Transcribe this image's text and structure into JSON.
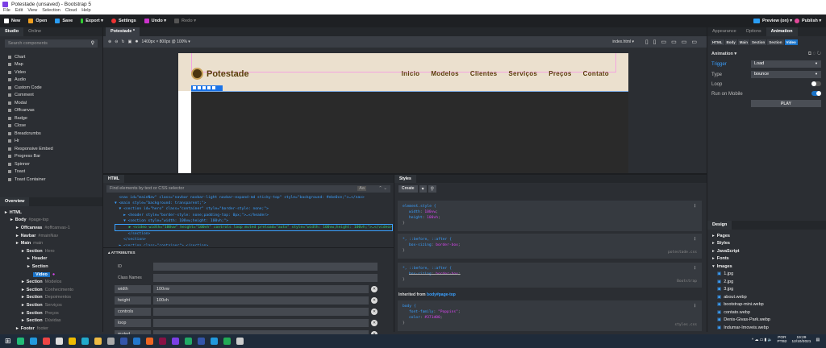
{
  "window": {
    "title": "Potestade (unsaved) - Bootstrap 5"
  },
  "menu": [
    "File",
    "Edit",
    "View",
    "Selection",
    "Cloud",
    "Help"
  ],
  "toolbar": {
    "new": "New",
    "open": "Open",
    "save": "Save",
    "export": "Export ▾",
    "settings": "Settings",
    "undo": "Undo ▾",
    "redo": "Redo ▾",
    "preview": "Preview (on) ▾",
    "publish": "Publish ▾"
  },
  "left": {
    "tabs": [
      "Studio",
      "Online"
    ],
    "search_placeholder": "Search components",
    "components": [
      "Chart",
      "Map",
      "Video",
      "Audio",
      "Custom Code",
      "Comment",
      "Modal",
      "Offcanvas",
      "Badge",
      "Close",
      "Breadcrumbs",
      "Hr",
      "Responsive Embed",
      "Progress Bar",
      "Spinner",
      "Toast",
      "Toast Container"
    ],
    "overview_tab": "Overview",
    "tree": [
      {
        "label": "HTML",
        "sub": "",
        "lvl": 0
      },
      {
        "label": "Body",
        "sub": "#page-top",
        "lvl": 1
      },
      {
        "label": "Offcanvas",
        "sub": "#offcanvas-1",
        "lvl": 2
      },
      {
        "label": "Navbar",
        "sub": "#mainNav",
        "lvl": 2
      },
      {
        "label": "Main",
        "sub": "main",
        "lvl": 2
      },
      {
        "label": "Section",
        "sub": "Hero",
        "lvl": 3
      },
      {
        "label": "Header",
        "sub": "",
        "lvl": 4
      },
      {
        "label": "Section",
        "sub": "",
        "lvl": 4
      },
      {
        "label": "Video",
        "sub": "",
        "lvl": 5,
        "selected": true
      },
      {
        "label": "Section",
        "sub": "Modelos",
        "lvl": 3
      },
      {
        "label": "Section",
        "sub": "Conhecimento",
        "lvl": 3
      },
      {
        "label": "Section",
        "sub": "Depoimentos",
        "lvl": 3
      },
      {
        "label": "Section",
        "sub": "Serviços",
        "lvl": 3
      },
      {
        "label": "Section",
        "sub": "Preços",
        "lvl": 3
      },
      {
        "label": "Section",
        "sub": "Dúvidas",
        "lvl": 3
      },
      {
        "label": "Footer",
        "sub": "footer",
        "lvl": 2
      }
    ]
  },
  "canvas": {
    "tab": "Potestade *",
    "size": "1400px × 800px @ 100% ▾",
    "file": "index.html ▾",
    "site": {
      "brand": "Potestade",
      "nav": [
        "Inicio",
        "Modelos",
        "Clientes",
        "Serviços",
        "Preços",
        "Contato"
      ]
    }
  },
  "html_panel": {
    "tab": "HTML",
    "find_placeholder": "Find elements by text or CSS selector",
    "case": "Aa",
    "lines": [
      "  <nav id=\"mainNav\" class=\"navbar navbar-light navbar-expand-md sticky-top\" style=\"background: #ebe0ce;\">…</nav>",
      "▼ <main style=\"background: transparent;\">",
      "  ▼ <section id=\"hero\" class=\"container\" style=\"border-style: none;\">",
      "    ▶ <header style=\"border-style: none;padding-top: 0px;\">…</header>",
      "    ▼ <section style=\"width: 100vw;height: 100vh;\">",
      "      ▶ <video width=\"100vw\" height=\"100vh\" controls loop muted preload=\"auto\" style=\"width: 100vw;height: 100vh;\">…</video>",
      "      </section>",
      "    </section>",
      "  ▶ <section class=\"container\">…</section>"
    ],
    "attributes_title": "ATTRIBUTES",
    "attrs": [
      {
        "k": "ID",
        "v": ""
      },
      {
        "k": "Class Names",
        "v": ""
      },
      {
        "k": "width",
        "v": "100vw"
      },
      {
        "k": "height",
        "v": "100vh"
      },
      {
        "k": "controls",
        "v": ""
      },
      {
        "k": "loop",
        "v": ""
      },
      {
        "k": "muted",
        "v": ""
      }
    ]
  },
  "styles": {
    "tab": "Styles",
    "create": "Create",
    "rules": [
      {
        "sel": "element.style {",
        "decls": [
          [
            "width",
            "100vw"
          ],
          [
            "height",
            "100vh"
          ]
        ],
        "src": ""
      },
      {
        "sel": "*, ::before, ::after {",
        "decls": [
          [
            "box-sizing",
            "border-box"
          ]
        ],
        "src": "potestade.css"
      },
      {
        "sel": "*, ::before, ::after {",
        "decls": [
          [
            "box-sizing",
            "border-box"
          ]
        ],
        "src": "Bootstrap"
      }
    ],
    "inherited_label": "Inherited from",
    "inherited_sel": "body#page-top",
    "body_rule": {
      "sel": "body {",
      "decls": [
        [
          "font-family",
          "\"Poppins\""
        ],
        [
          "color",
          "#371d00"
        ]
      ],
      "src": "styles.css"
    }
  },
  "right": {
    "tabs": [
      "Appearance",
      "Options",
      "Animation"
    ],
    "breadcrumbs": [
      "HTML",
      "Body",
      "Main",
      "Section",
      "Section",
      "Video"
    ],
    "animation": {
      "title": "Animation ▾",
      "trigger_label": "Trigger",
      "trigger": "Load",
      "type_label": "Type",
      "type": "bounce",
      "loop_label": "Loop",
      "loop": false,
      "mobile_label": "Run on Mobile",
      "mobile": true,
      "play": "PLAY"
    },
    "design_tab": "Design",
    "design": [
      "Pages",
      "Styles",
      "JavaScript",
      "Fonts",
      "Images"
    ],
    "images": [
      "1.jpg",
      "2.jpg",
      "3.jpg",
      "about.webp",
      "bootstrap-mini.webp",
      "contato.webp",
      "Denis-Givas-Park.webp",
      "Indumar-Imoveis.webp"
    ]
  },
  "taskbar": {
    "lang1": "POR",
    "lang2": "PTB2",
    "time": "19:29",
    "date": "12/10/2021"
  },
  "colors": {
    "accent": "#1a73c8",
    "magenta": "#d946ef",
    "brand": "#5a3d0a",
    "header_bg": "#ebe0ce"
  }
}
